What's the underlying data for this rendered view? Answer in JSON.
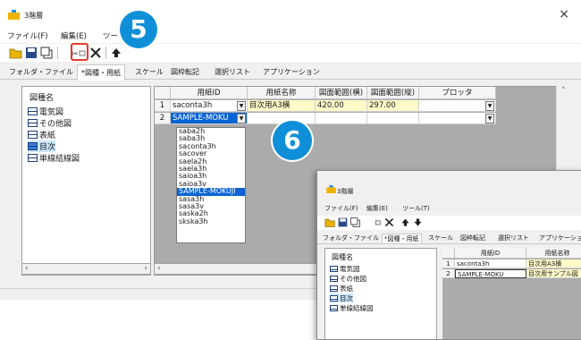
{
  "window": {
    "title": "3階層",
    "close_glyph": "×"
  },
  "menu": [
    "ファイル(F)",
    "編集(E)",
    "ツー"
  ],
  "callouts": {
    "step5": "5",
    "step6": "6"
  },
  "tabs": [
    {
      "label": "フォルダ・ファイル"
    },
    {
      "label": "*図種・用紙"
    },
    {
      "label": "スケール"
    },
    {
      "label": "図枠転記"
    },
    {
      "label": "選択リスト"
    },
    {
      "label": "アプリケーション"
    }
  ],
  "tree": {
    "title": "図種名",
    "items": [
      "電気図",
      "その他図",
      "表紙",
      "目次",
      "単線結線図"
    ],
    "selected_index": 3
  },
  "grid": {
    "headers": [
      "用紙ID",
      "用紙名称",
      "図面範囲(横)",
      "図面範囲(縦)",
      "プロッタ"
    ],
    "rows": [
      {
        "num": "1",
        "paper_id": "saconta3h",
        "paper_name": "目次用A3横",
        "width": "420.00",
        "height": "297.00",
        "plotter": ""
      },
      {
        "num": "2",
        "paper_id": "SAMPLE-MOKU",
        "paper_name": "",
        "width": "",
        "height": "",
        "plotter": ""
      }
    ]
  },
  "dropdown_options": [
    "saba2h",
    "saba3h",
    "saconta3h",
    "sacover",
    "saela2h",
    "saela3h",
    "saioa3h",
    "saioa3v",
    "SAMPLE-MOKUJI",
    "sasa3h",
    "sasa3v",
    "saska2h",
    "skska3h"
  ],
  "dropdown_selected_index": 8,
  "inset": {
    "title": "3階層",
    "menu": [
      "ファイル(F)",
      "編集(E)",
      "ツール(T)"
    ],
    "tabs": [
      "フォルダ・ファイル",
      "*図種・用紙",
      "スケール",
      "図枠転記",
      "選択リスト",
      "アプリケーション"
    ],
    "tree_title": "図種名",
    "tree_items": [
      "電気図",
      "その他図",
      "表紙",
      "目次",
      "単線結線図"
    ],
    "headers": [
      "用紙ID",
      "用紙名称"
    ],
    "rows": [
      {
        "num": "1",
        "paper_id": "saconta3h",
        "paper_name": "目次用A3横"
      },
      {
        "num": "2",
        "paper_id": "SAMPLE-MOKU",
        "paper_name": "目次用サンプル図"
      }
    ]
  },
  "colors": {
    "accent": "#0f8fd8",
    "highlight": "#e8362d",
    "selection": "#0a64d6",
    "row_yellow": "#fff9c8"
  }
}
